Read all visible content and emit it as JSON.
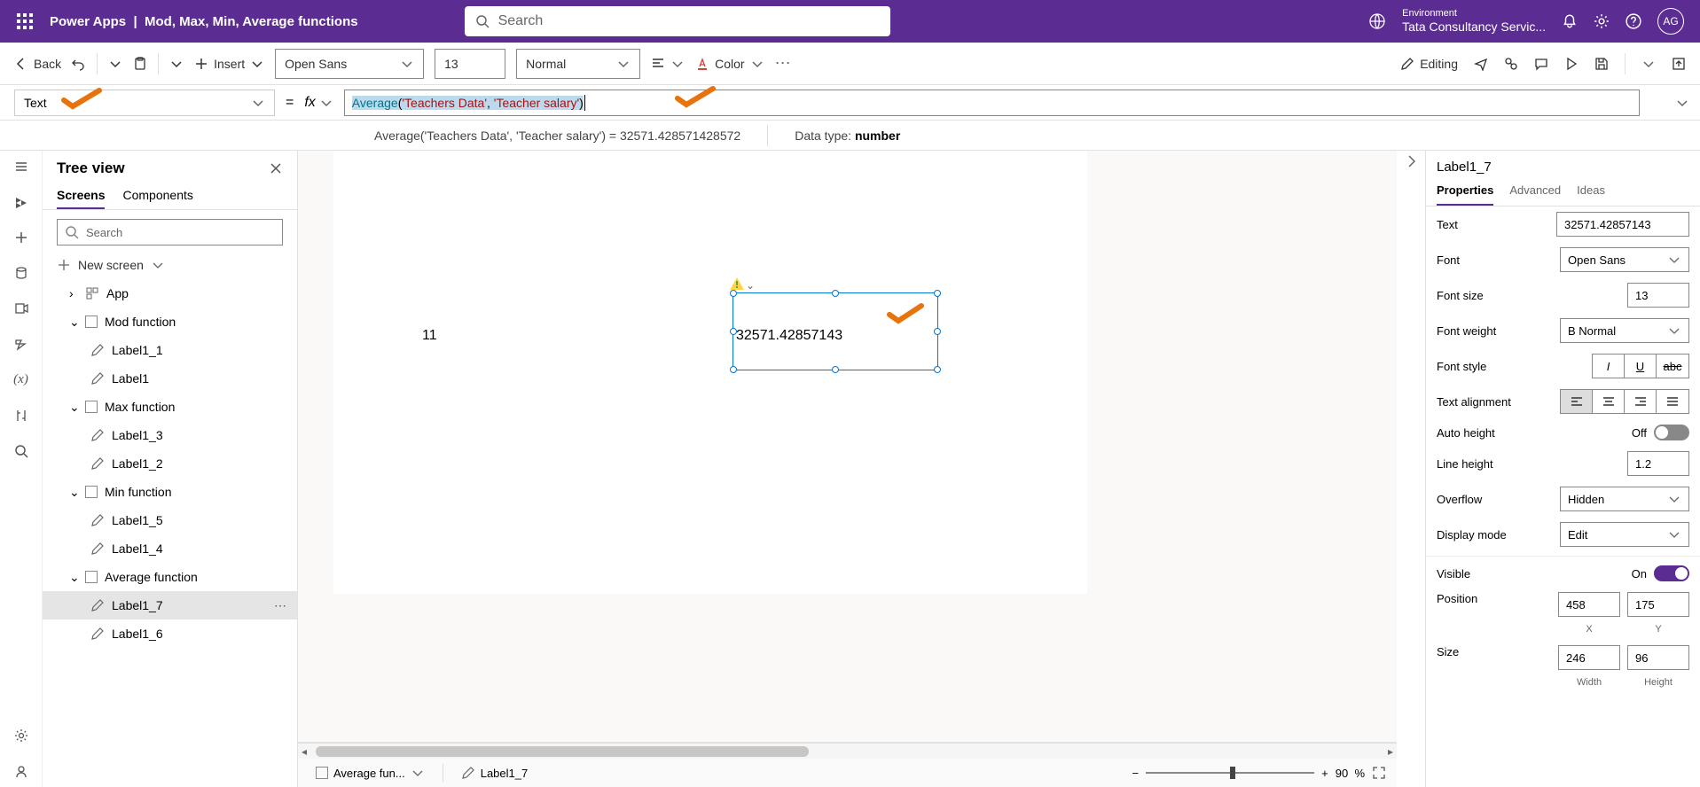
{
  "header": {
    "app": "Power Apps",
    "page_title": "Mod, Max, Min, Average functions",
    "search_placeholder": "Search",
    "env_label": "Environment",
    "env_value": "Tata Consultancy Servic...",
    "avatar": "AG"
  },
  "toolbar": {
    "back": "Back",
    "insert": "Insert",
    "font": "Open Sans",
    "font_size": "13",
    "font_weight": "Normal",
    "color": "Color",
    "editing": "Editing"
  },
  "formula": {
    "property": "Text",
    "fx_label": "fx",
    "text_raw": "Average('Teachers Data', 'Teacher salary')",
    "result_expr": "Average('Teachers Data', 'Teacher salary')  =  32571.428571428572",
    "data_type_label": "Data type:",
    "data_type": "number"
  },
  "tree": {
    "title": "Tree view",
    "tab_screens": "Screens",
    "tab_components": "Components",
    "search_placeholder": "Search",
    "new_screen": "New screen",
    "app": "App",
    "groups": [
      {
        "name": "Mod function",
        "items": [
          "Label1_1",
          "Label1"
        ]
      },
      {
        "name": "Max function",
        "items": [
          "Label1_3",
          "Label1_2"
        ]
      },
      {
        "name": "Min function",
        "items": [
          "Label1_5",
          "Label1_4"
        ]
      },
      {
        "name": "Average function",
        "items": [
          "Label1_7",
          "Label1_6"
        ]
      }
    ]
  },
  "canvas": {
    "label_left": "11",
    "label_sel": "32571.42857143",
    "footer_screen": "Average fun...",
    "footer_selected": "Label1_7",
    "zoom": "90",
    "zoom_pct": "%"
  },
  "props": {
    "control": "Label1_7",
    "tabs": {
      "properties": "Properties",
      "advanced": "Advanced",
      "ideas": "Ideas"
    },
    "text_label": "Text",
    "text_value": "32571.42857143",
    "font_label": "Font",
    "font_value": "Open Sans",
    "fontsize_label": "Font size",
    "fontsize_value": "13",
    "fontweight_label": "Font weight",
    "fontweight_value": "B  Normal",
    "fontstyle_label": "Font style",
    "textalign_label": "Text alignment",
    "autoheight_label": "Auto height",
    "autoheight_value": "Off",
    "lineheight_label": "Line height",
    "lineheight_value": "1.2",
    "overflow_label": "Overflow",
    "overflow_value": "Hidden",
    "displaymode_label": "Display mode",
    "displaymode_value": "Edit",
    "visible_label": "Visible",
    "visible_value": "On",
    "position_label": "Position",
    "position_x": "458",
    "position_y": "175",
    "pos_x_label": "X",
    "pos_y_label": "Y",
    "size_label": "Size",
    "size_w": "246",
    "size_h": "96",
    "size_w_label": "Width",
    "size_h_label": "Height"
  }
}
